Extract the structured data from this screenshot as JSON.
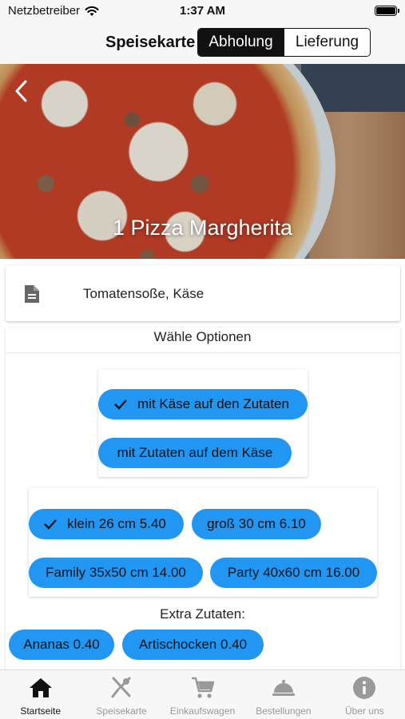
{
  "status_bar": {
    "carrier": "Netzbetreiber",
    "time": "1:37 AM"
  },
  "nav": {
    "title": "Speisekarte",
    "segments": [
      "Abholung",
      "Lieferung"
    ],
    "active_segment": "Abholung"
  },
  "hero": {
    "title": "1 Pizza Margherita"
  },
  "description": {
    "text": "Tomatensoße, Käse"
  },
  "options": {
    "title": "Wähle Optionen",
    "topping_order": [
      {
        "label": "mit Käse auf den Zutaten",
        "selected": true
      },
      {
        "label": "mit Zutaten auf dem Käse",
        "selected": false
      }
    ],
    "sizes": [
      {
        "label": "klein 26 cm 5.40",
        "selected": true
      },
      {
        "label": "groß 30 cm 6.10",
        "selected": false
      },
      {
        "label": "Family 35x50 cm 14.00",
        "selected": false
      },
      {
        "label": "Party 40x60 cm 16.00",
        "selected": false
      }
    ],
    "extras_title": "Extra Zutaten:",
    "extras": [
      {
        "label": "Ananas 0.40",
        "selected": false
      },
      {
        "label": "Artischocken 0.40",
        "selected": false
      }
    ]
  },
  "colors": {
    "chip": "#2196f3",
    "active_tab": "#111111",
    "inactive_tab": "#999999"
  },
  "tabs": [
    {
      "label": "Startseite",
      "icon": "home-icon",
      "active": true
    },
    {
      "label": "Speisekarte",
      "icon": "cutlery-icon",
      "active": false
    },
    {
      "label": "Einkaufswagen",
      "icon": "cart-icon",
      "active": false
    },
    {
      "label": "Bestellungen",
      "icon": "cloche-icon",
      "active": false
    },
    {
      "label": "Über uns",
      "icon": "info-icon",
      "active": false
    }
  ]
}
